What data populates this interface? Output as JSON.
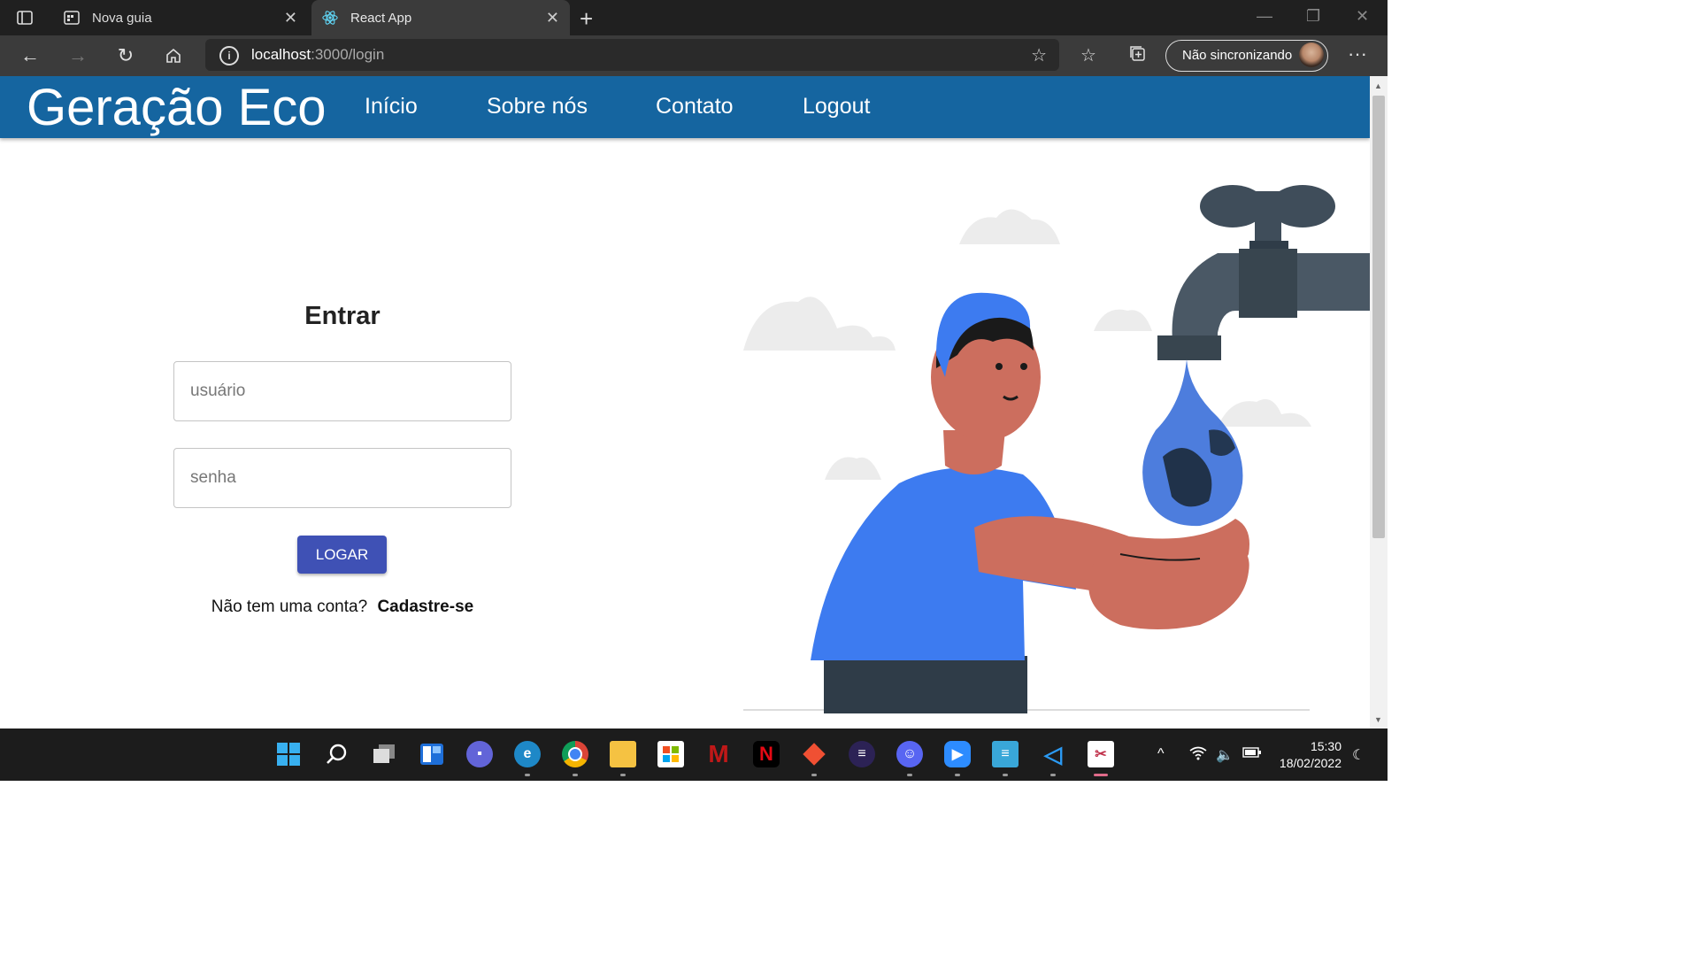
{
  "browser": {
    "tabs": [
      {
        "title": "Nova guia",
        "icon": "new-tab-page-icon",
        "active": false
      },
      {
        "title": "React App",
        "icon": "react-logo-icon",
        "active": true
      }
    ],
    "address": {
      "host": "localhost",
      "rest": ":3000/login"
    },
    "profile_label": "Não sincronizando"
  },
  "app": {
    "brand": "Geração Eco",
    "nav": [
      "Início",
      "Sobre nós",
      "Contato",
      "Logout"
    ],
    "login": {
      "title": "Entrar",
      "username_placeholder": "usuário",
      "password_placeholder": "senha",
      "submit_label": "LOGAR",
      "signup_prompt": "Não tem uma conta?",
      "signup_link": "Cadastre-se"
    },
    "colors": {
      "appbar": "#1565a0",
      "button": "#3f51b5",
      "shirt": "#3d7bf0",
      "skin": "#cc6e5e"
    }
  },
  "taskbar": {
    "apps": [
      "windows-start-icon",
      "search-icon",
      "task-view-icon",
      "widgets-icon",
      "teams-chat-icon",
      "edge-icon",
      "chrome-icon",
      "file-explorer-icon",
      "microsoft-store-icon",
      "mcafee-icon",
      "netflix-icon",
      "git-icon",
      "eclipse-icon",
      "discord-icon",
      "zoom-icon",
      "notepad-icon",
      "vscode-icon",
      "snipping-tool-icon"
    ],
    "time": "15:30",
    "date": "18/02/2022"
  }
}
